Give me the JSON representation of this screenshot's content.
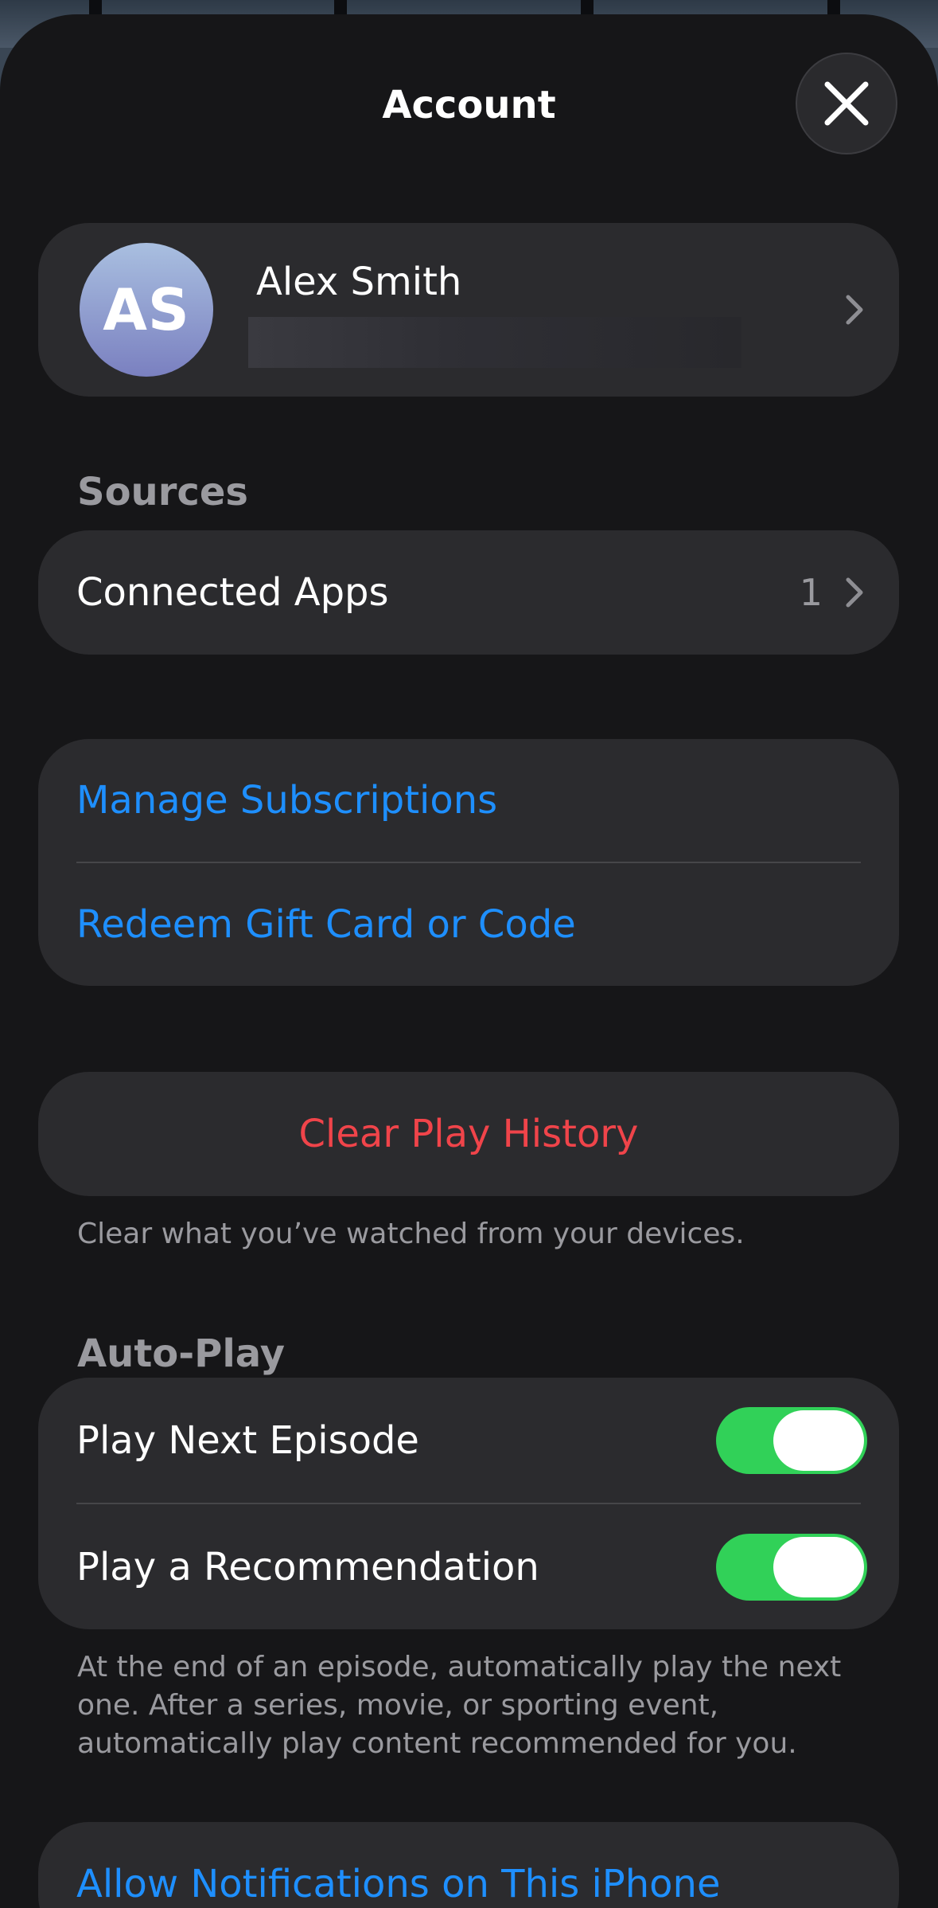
{
  "header": {
    "title": "Account"
  },
  "profile": {
    "initials": "AS",
    "name": "Alex Smith"
  },
  "sources": {
    "section_title": "Sources",
    "connected_apps_label": "Connected Apps",
    "connected_apps_count": "1"
  },
  "store": {
    "manage_subscriptions_label": "Manage Subscriptions",
    "redeem_label": "Redeem Gift Card or Code"
  },
  "history": {
    "clear_label": "Clear Play History",
    "footnote": "Clear what you’ve watched from your devices."
  },
  "autoplay": {
    "section_title": "Auto-Play",
    "play_next_label": "Play Next Episode",
    "play_next_on": true,
    "play_recommendation_label": "Play a Recommendation",
    "play_recommendation_on": true,
    "footnote": "At the end of an episode, automatically play the next one. After a series, movie, or sporting event, automatically play content recommended for you."
  },
  "notifications": {
    "allow_label": "Allow Notifications on This iPhone"
  },
  "colors": {
    "accent_blue": "#1e8fff",
    "destructive_red": "#f0444a",
    "toggle_on": "#31d158",
    "sheet_background": "#161618",
    "card_background": "#2b2b2e"
  }
}
